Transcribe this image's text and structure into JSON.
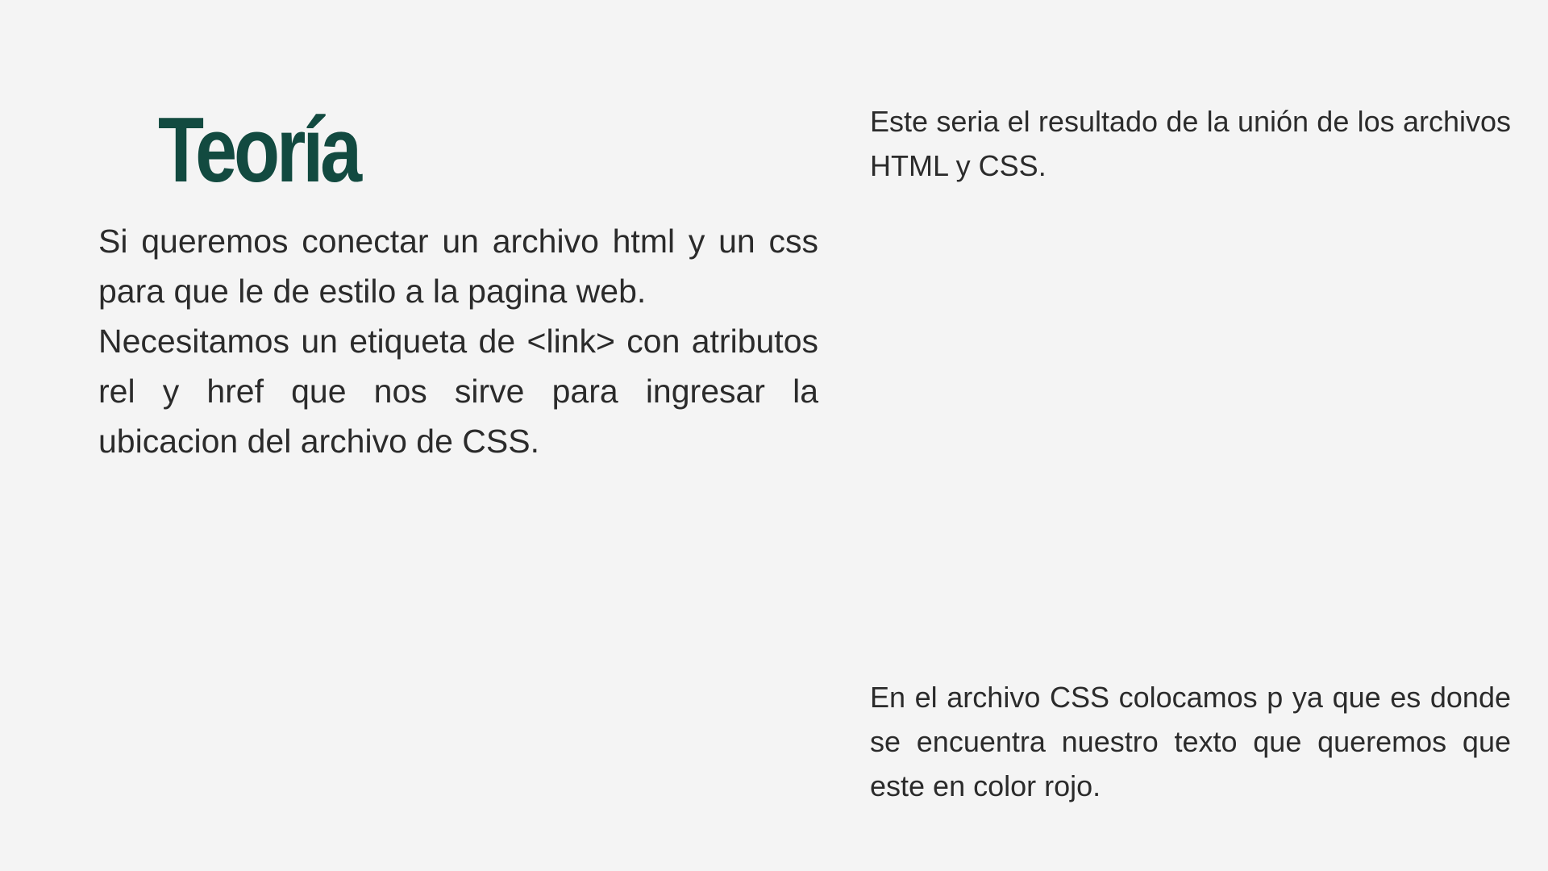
{
  "slide": {
    "title": "Teoría",
    "left_paragraphs": [
      "Si queremos conectar un archivo html y un css para que le de estilo a la pagina web.",
      "Necesitamos un etiqueta de <link> con atributos rel y href que nos sirve para ingresar la ubicacion del archivo de CSS."
    ],
    "right_top_text": "Este seria el resultado de la unión de los archivos HTML y CSS.",
    "right_bottom_text": "En el archivo CSS colocamos p ya que es donde se encuentra nuestro texto que queremos que este en color rojo."
  },
  "colors": {
    "background": "#f4f4f4",
    "title": "#124a40",
    "body_text": "#2b2b2b"
  }
}
